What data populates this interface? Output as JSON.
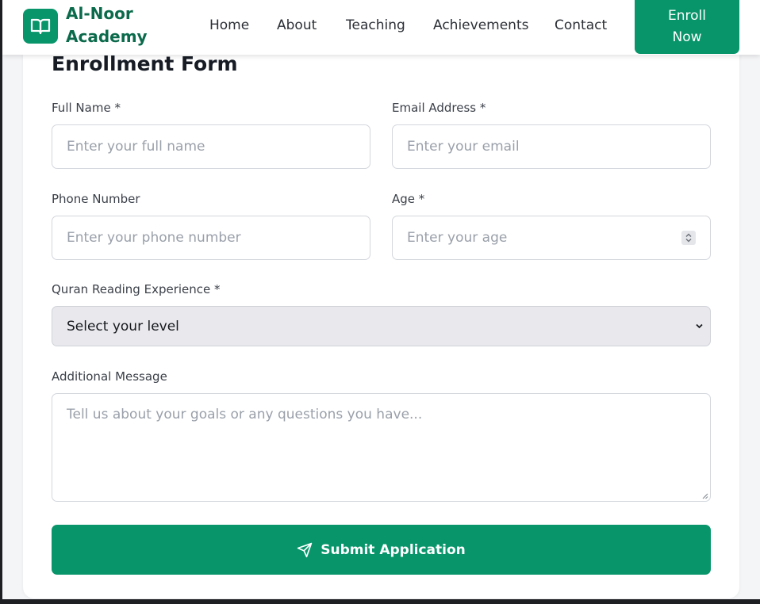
{
  "navbar": {
    "brand_line1": "Al-Noor",
    "brand_line2": "Academy",
    "links": [
      "Home",
      "About",
      "Teaching",
      "Achievements",
      "Contact"
    ],
    "enroll_label": "Enroll Now",
    "logo_icon": "book-open-icon"
  },
  "form": {
    "title": "Enrollment Form",
    "full_name": {
      "label": "Full Name *",
      "placeholder": "Enter your full name",
      "value": ""
    },
    "email": {
      "label": "Email Address *",
      "placeholder": "Enter your email",
      "value": ""
    },
    "phone": {
      "label": "Phone Number",
      "placeholder": "Enter your phone number",
      "value": ""
    },
    "age": {
      "label": "Age *",
      "placeholder": "Enter your age",
      "value": ""
    },
    "experience": {
      "label": "Quran Reading Experience *",
      "selected": "Select your level"
    },
    "message": {
      "label": "Additional Message",
      "placeholder": "Tell us about your goals or any questions you have..."
    },
    "submit_label": "Submit Application",
    "submit_icon": "send-icon"
  },
  "colors": {
    "primary": "#08956a",
    "brand_text": "#0b6a4b"
  }
}
